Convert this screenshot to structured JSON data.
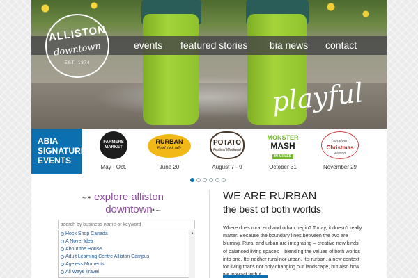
{
  "nav": {
    "items": [
      "events",
      "featured stories",
      "bia news",
      "contact"
    ]
  },
  "logo": {
    "line1": "ALLISTON",
    "line2": "downtown",
    "line3": "EST. 1874"
  },
  "hero": {
    "tagline": "playful"
  },
  "events": {
    "label_lines": [
      "ABIA",
      "SIGNATURE",
      "EVENTS"
    ],
    "items": [
      {
        "badge_lines": [
          "FARMERS",
          "MARKET"
        ],
        "date": "May - Oct."
      },
      {
        "badge_lines": [
          "RURBAN",
          "Food truck rally"
        ],
        "date": "June 20"
      },
      {
        "badge_lines": [
          "POTATO",
          "Festival Weekend"
        ],
        "date": "August 7 - 9"
      },
      {
        "badge_lines": [
          "MONSTER",
          "MASH",
          "IN MOLES"
        ],
        "date": "October 31"
      },
      {
        "badge_lines": [
          "Hometown",
          "Christmas",
          "Alliston"
        ],
        "date": "November 29"
      }
    ]
  },
  "slider": {
    "count": 6,
    "active": 0
  },
  "explore": {
    "title_line1": "explore alliston",
    "title_line2": "downtown",
    "search_placeholder": "search by business name or keyword",
    "businesses": [
      "Hock Shop Canada",
      "A Novel Idea",
      "About the House",
      "Adult Learning Centre Alliston Campus",
      "Ageless Moments",
      "All Ways Travel"
    ]
  },
  "about": {
    "heading": "WE ARE RURBAN",
    "subheading": "the best of both worlds",
    "body": "Where does rural end and urban begin? Today, it doesn't really matter. Because the boundary lines between the two are blurring. Rural and urban are integrating – creative new kinds of balanced living spaces – blending the values of both worlds into one. It's neither rural nor urban. It's rurban, a new context for living that's not only changing our landscape, but also how we interact with it."
  },
  "colors": {
    "accent_blue": "#0b6fb0",
    "explore_purple": "#8b4c9d",
    "nav_bar": "#464646"
  }
}
